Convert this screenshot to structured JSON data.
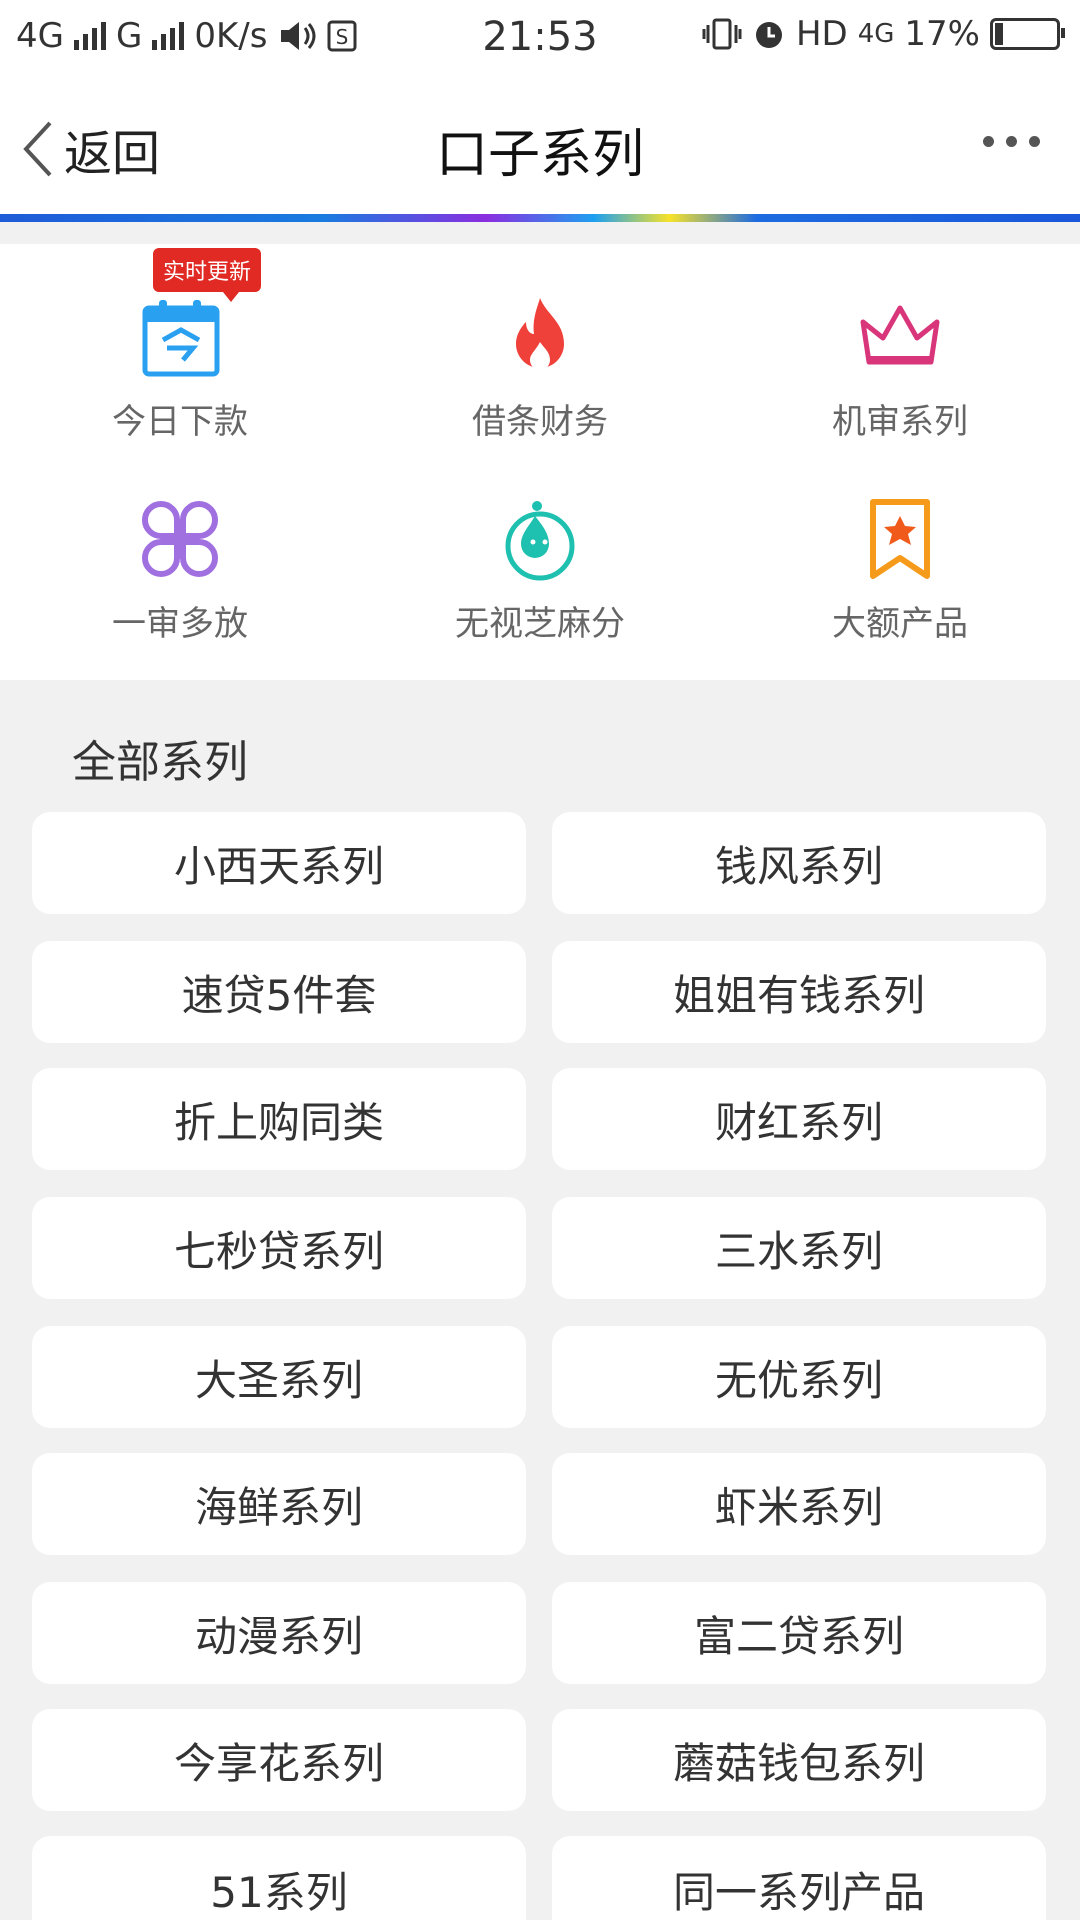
{
  "status_bar": {
    "network1": "4G",
    "network2": "G",
    "speed": "0K/s",
    "time": "21:53",
    "hd": "HD",
    "network3": "4G",
    "battery": "17%"
  },
  "header": {
    "back_label": "返回",
    "title": "口子系列"
  },
  "quick_categories": {
    "badge": "实时更新",
    "items": [
      {
        "label": "今日下款",
        "icon": "calendar-icon"
      },
      {
        "label": "借条财务",
        "icon": "fire-icon"
      },
      {
        "label": "机审系列",
        "icon": "crown-icon"
      },
      {
        "label": "一审多放",
        "icon": "clover-icon"
      },
      {
        "label": "无视芝麻分",
        "icon": "sesame-drop-icon"
      },
      {
        "label": "大额产品",
        "icon": "star-bookmark-icon"
      }
    ]
  },
  "all_series": {
    "title": "全部系列",
    "items": [
      "小西天系列",
      "钱风系列",
      "速贷5件套",
      "姐姐有钱系列",
      "折上购同类",
      "财红系列",
      "七秒贷系列",
      "三水系列",
      "大圣系列",
      "无优系列",
      "海鲜系列",
      "虾米系列",
      "动漫系列",
      "富二贷系列",
      "今享花系列",
      "蘑菇钱包系列",
      "51系列",
      "同一系列产品"
    ]
  },
  "colors": {
    "badge": "#e02a23",
    "calendar": "#2aa0f0",
    "fire": "#f0403a",
    "crown": "#d9357a",
    "clover": "#a070e0",
    "sesame": "#1ec0b0",
    "bookmark": "#f59a1b"
  }
}
